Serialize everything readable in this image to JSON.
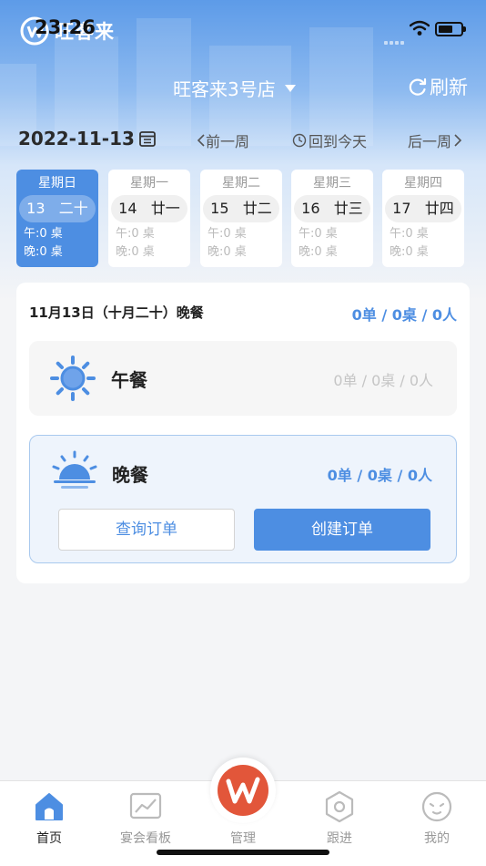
{
  "status_bar": {
    "time": "23:26",
    "battery_level": 0.65
  },
  "app": {
    "logo_text": "旺客来"
  },
  "header": {
    "store_name": "旺客来3号店",
    "refresh_label": "刷新"
  },
  "date_nav": {
    "current_date": "2022-11-13",
    "prev_week": "前一周",
    "today": "回到今天",
    "next_week": "后一周"
  },
  "week_days": [
    {
      "weekday": "星期日",
      "date": "13",
      "lunar": "二十",
      "lunch": "午:0 桌",
      "dinner": "晚:0 桌",
      "active": true
    },
    {
      "weekday": "星期一",
      "date": "14",
      "lunar": "廿一",
      "lunch": "午:0 桌",
      "dinner": "晚:0 桌",
      "active": false
    },
    {
      "weekday": "星期二",
      "date": "15",
      "lunar": "廿二",
      "lunch": "午:0 桌",
      "dinner": "晚:0 桌",
      "active": false
    },
    {
      "weekday": "星期三",
      "date": "16",
      "lunar": "廿三",
      "lunch": "午:0 桌",
      "dinner": "晚:0 桌",
      "active": false
    },
    {
      "weekday": "星期四",
      "date": "17",
      "lunar": "廿四",
      "lunch": "午:0 桌",
      "dinner": "晚:0 桌",
      "active": false
    }
  ],
  "summary": {
    "title": "11月13日（十月二十）晚餐",
    "stats": "0单 / 0桌 / 0人"
  },
  "meals": {
    "lunch": {
      "name": "午餐",
      "stats": "0单 / 0桌 / 0人",
      "icon": "sun-icon"
    },
    "dinner": {
      "name": "晚餐",
      "stats": "0单 / 0桌 / 0人",
      "icon": "sunset-icon"
    }
  },
  "actions": {
    "query_label": "查询订单",
    "create_label": "创建订单"
  },
  "tabbar": {
    "home": "首页",
    "dashboard": "宴会看板",
    "manage": "管理",
    "follow": "跟进",
    "mine": "我的"
  },
  "colors": {
    "accent": "#4d8ee2",
    "header_gradient_top": "#5d9be8",
    "muted": "#999999"
  }
}
